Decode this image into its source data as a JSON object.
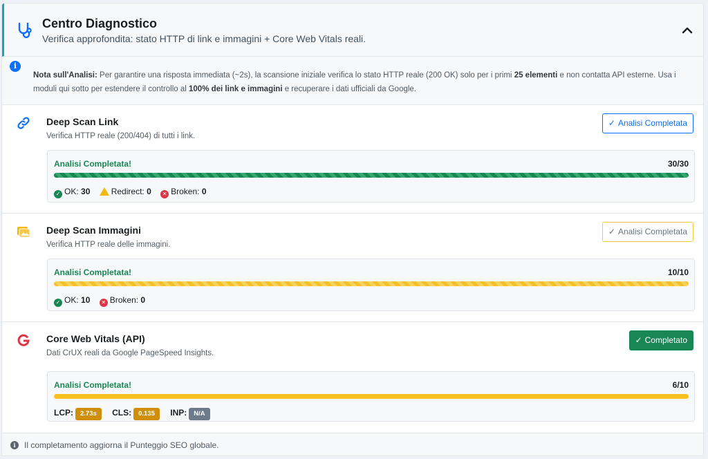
{
  "header": {
    "icon": "stethoscope-icon",
    "title": "Centro Diagnostico",
    "subtitle": "Verifica approfondita: stato HTTP di link e immagini + Core Web Vitals reali.",
    "collapse_icon": "chevron-up-icon"
  },
  "note": {
    "icon": "info-icon",
    "label": "Nota sull'Analisi:",
    "text1": " Per garantire una risposta immediata (~2s), la scansione iniziale verifica lo stato HTTP reale (200 OK) solo per i primi ",
    "bold1": "25 elementi",
    "text2": " e non contatta API esterne. Usa i moduli qui sotto per estendere il controllo al ",
    "bold2": "100% dei link e immagini",
    "text3": " e recuperare i dati ufficiali da Google."
  },
  "modules": {
    "links": {
      "icon": "link-icon",
      "title": "Deep Scan Link",
      "desc": "Verifica HTTP reale (200/404) di tutti i link.",
      "button": "Analisi Completata",
      "status": "Analisi Completata!",
      "count": "30/30",
      "progress": 1.0,
      "ok_label": "OK:",
      "ok_value": "30",
      "redirect_label": "Redirect:",
      "redirect_value": "0",
      "broken_label": "Broken:",
      "broken_value": "0"
    },
    "images": {
      "icon": "image-icon",
      "title": "Deep Scan Immagini",
      "desc": "Verifica HTTP reale delle immagini.",
      "button": "Analisi Completata",
      "status": "Analisi Completata!",
      "count": "10/10",
      "progress": 1.0,
      "ok_label": "OK:",
      "ok_value": "10",
      "broken_label": "Broken:",
      "broken_value": "0"
    },
    "cwv": {
      "icon": "google-icon",
      "title": "Core Web Vitals (API)",
      "desc": "Dati CrUX reali da Google PageSpeed Insights.",
      "button": "Completato",
      "status": "Analisi Completata!",
      "count": "6/10",
      "progress": 1.0,
      "lcp_label": "LCP:",
      "lcp_value": "2.73s",
      "cls_label": "CLS:",
      "cls_value": "0.135",
      "inp_label": "INP:",
      "inp_value": "N/A"
    }
  },
  "footer": {
    "icon": "info-icon",
    "text": "Il completamento aggiorna il Punteggio SEO globale."
  },
  "colors": {
    "accent_cyan": "#12a3c6",
    "primary": "#0d6efd",
    "success": "#198754",
    "warning": "#fbc11e",
    "danger": "#dc3545"
  }
}
